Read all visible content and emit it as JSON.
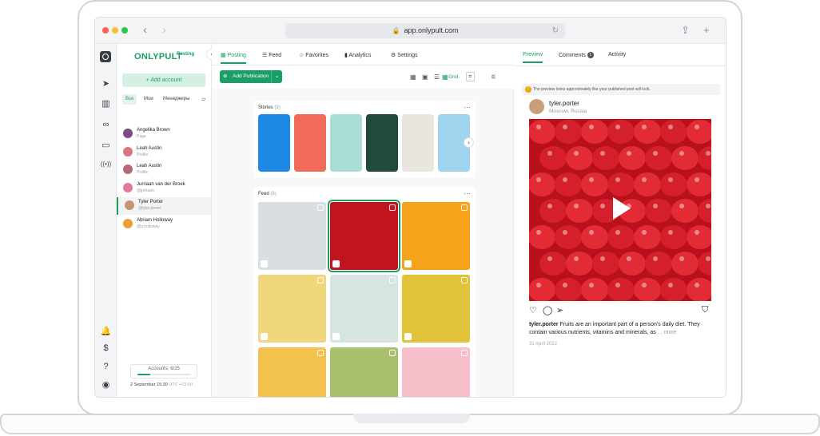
{
  "browser": {
    "url": "app.onlypult.com"
  },
  "brand": {
    "name": "ONLYPULT",
    "tag": "Posting"
  },
  "accounts_panel": {
    "add_label": "Add account",
    "filters": [
      "Все",
      "Мои",
      "Менеджеры"
    ],
    "items": [
      {
        "name": "Angelika Brown",
        "sub": "Page",
        "color": "#7c4a8a"
      },
      {
        "name": "Leah Austin",
        "sub": "Profile",
        "color": "#d9747e"
      },
      {
        "name": "Leah Austin",
        "sub": "Profile",
        "color": "#b86a7b"
      },
      {
        "name": "Jurriaan van der Broek",
        "sub": "@jurriaan",
        "color": "#e07b9a"
      },
      {
        "name": "Tyler Porter",
        "sub": "@tyler.porter",
        "color": "#c79373"
      },
      {
        "name": "Abriam Holloway",
        "sub": "@a.holloway",
        "color": "#e8a03c"
      }
    ],
    "selected_index": 4,
    "accounts_count": "Accounts: 6/25",
    "accounts_progress": 0.24,
    "date": "2 September 15:30",
    "utc": "UTC +03:00"
  },
  "main_tabs": [
    {
      "label": "Posting",
      "icon": "calendar-icon"
    },
    {
      "label": "Feed",
      "icon": "feed-icon"
    },
    {
      "label": "Favorites",
      "icon": "star-icon"
    },
    {
      "label": "Analytics",
      "icon": "analytics-icon"
    },
    {
      "label": "Settings",
      "icon": "gear-icon"
    }
  ],
  "toolbar": {
    "add_publication": "Add Publication",
    "grid_label": "Grid"
  },
  "stories": {
    "title": "Stories",
    "count": "(9)",
    "colors": [
      "#1e88e5",
      "#f06b5a",
      "#a9ddd6",
      "#1f4a3c",
      "#e9e5df",
      "#9fd4ef"
    ]
  },
  "feed": {
    "title": "Feed",
    "count": "(9)",
    "colors": [
      "#d9dee3",
      "#c0141f",
      "#f7a21b",
      "#f1d77c",
      "#d7e5e2",
      "#e0c338",
      "#f3c24d",
      "#a9c06e",
      "#f6bfca"
    ],
    "selected_index": 1
  },
  "preview": {
    "tabs": [
      "Preview",
      "Comments",
      "Activity"
    ],
    "comments_badge": "1",
    "notice": "The preview looks approximately like your published post will look.",
    "username": "tyler.porter",
    "location": "Moscow, Russia",
    "caption_user": "tyler.porter",
    "caption": "Fruits are an important part of a person's daily diet. They contain various nutrients, vitamins and minerals, as",
    "more": "... more",
    "date": "31 April 2022",
    "image_color": "#b9101e"
  }
}
